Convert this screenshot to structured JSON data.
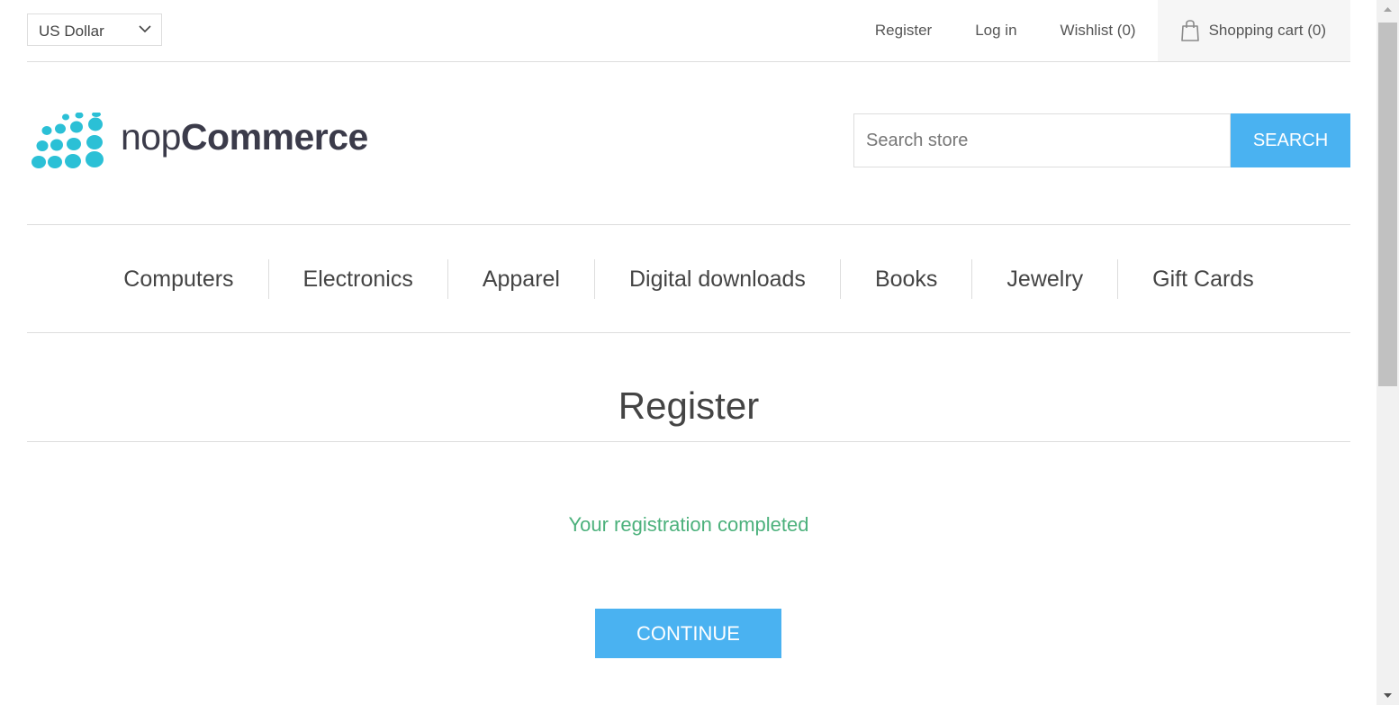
{
  "header": {
    "currency": "US Dollar",
    "links": {
      "register": "Register",
      "login": "Log in",
      "wishlist": "Wishlist (0)",
      "cart": "Shopping cart (0)"
    }
  },
  "logo": {
    "text_light": "nop",
    "text_bold": "Commerce",
    "accent_color": "#2bc0d6"
  },
  "search": {
    "placeholder": "Search store",
    "button_label": "Search"
  },
  "menu": {
    "items": [
      "Computers",
      "Electronics",
      "Apparel",
      "Digital downloads",
      "Books",
      "Jewelry",
      "Gift Cards"
    ]
  },
  "main": {
    "title": "Register",
    "result": "Your registration completed",
    "continue_label": "Continue"
  },
  "colors": {
    "primary": "#4ab2f1",
    "success": "#4cb17c"
  }
}
